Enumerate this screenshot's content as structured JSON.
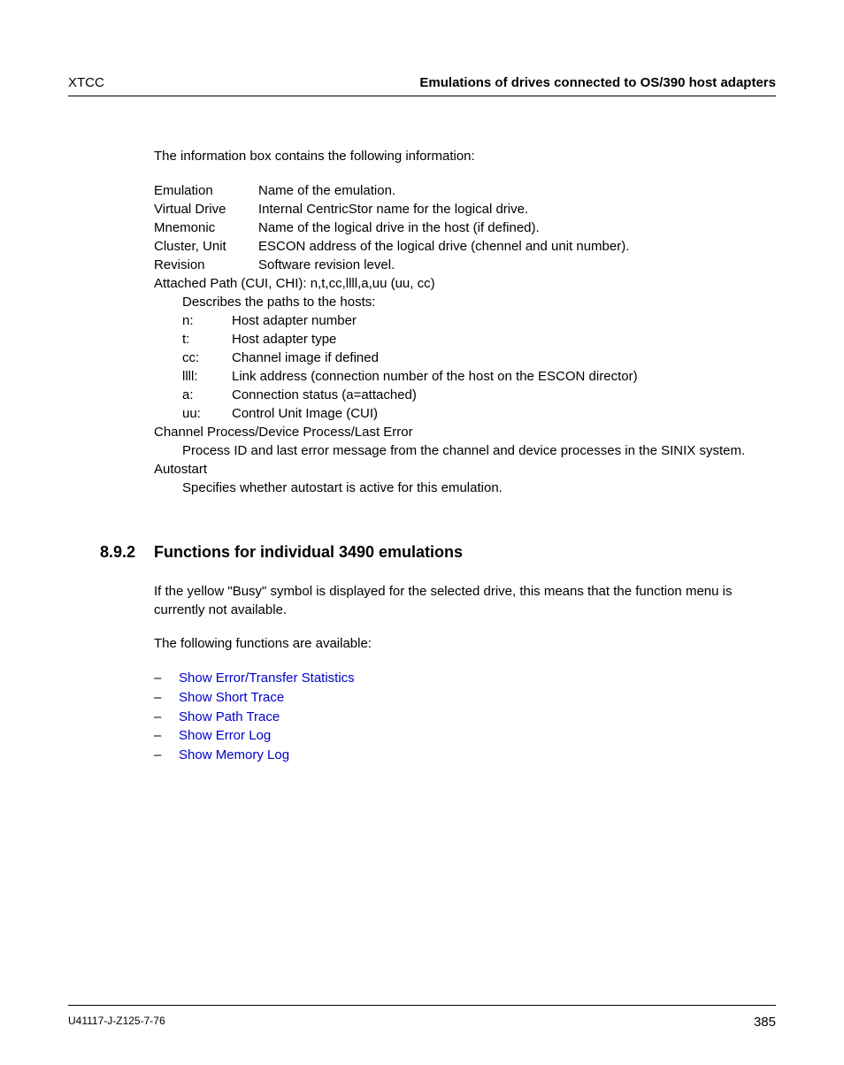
{
  "header": {
    "left": "XTCC",
    "right": "Emulations of drives connected to OS/390 host adapters"
  },
  "intro": "The information box contains the following information:",
  "defs": [
    {
      "term": "Emulation",
      "desc": "Name of the emulation."
    },
    {
      "term": "Virtual Drive",
      "desc": "Internal CentricStor name for the logical drive."
    },
    {
      "term": "Mnemonic",
      "desc": "Name of the logical drive in the host (if defined)."
    },
    {
      "term": "Cluster, Unit",
      "desc": "ESCON address of the logical drive (chennel and unit number)."
    },
    {
      "term": "Revision",
      "desc": "Software revision level."
    }
  ],
  "attached_path_line": "Attached Path (CUI, CHI): n,t,cc,llll,a,uu (uu, cc)",
  "attached_path_intro": "Describes the paths to the hosts:",
  "path_terms": [
    {
      "term": "n:",
      "desc": "Host adapter number"
    },
    {
      "term": "t:",
      "desc": "Host adapter type"
    },
    {
      "term": "cc:",
      "desc": "Channel image if defined"
    },
    {
      "term": "llll:",
      "desc": "Link address (connection number of the host on the ESCON director)"
    },
    {
      "term": "a:",
      "desc": "Connection status (a=attached)"
    },
    {
      "term": "uu:",
      "desc": "Control Unit Image (CUI)"
    }
  ],
  "channel_process_line": "Channel Process/Device Process/Last Error",
  "channel_process_desc": "Process ID and last error message from the channel and device processes in the SINIX system.",
  "autostart_term": "Autostart",
  "autostart_desc": "Specifies whether autostart is active for this emulation.",
  "section": {
    "number": "8.9.2",
    "title": "Functions for individual 3490 emulations"
  },
  "busy_para": "If the yellow \"Busy\" symbol is displayed for the selected drive, this means that the function menu is currently not available.",
  "funcs_intro": "The following functions are available:",
  "links": [
    "Show Error/Transfer Statistics",
    "Show Short Trace",
    "Show Path Trace",
    "Show Error Log",
    "Show Memory Log"
  ],
  "footer": {
    "left": "U41117-J-Z125-7-76",
    "page": "385"
  },
  "dash": "–"
}
